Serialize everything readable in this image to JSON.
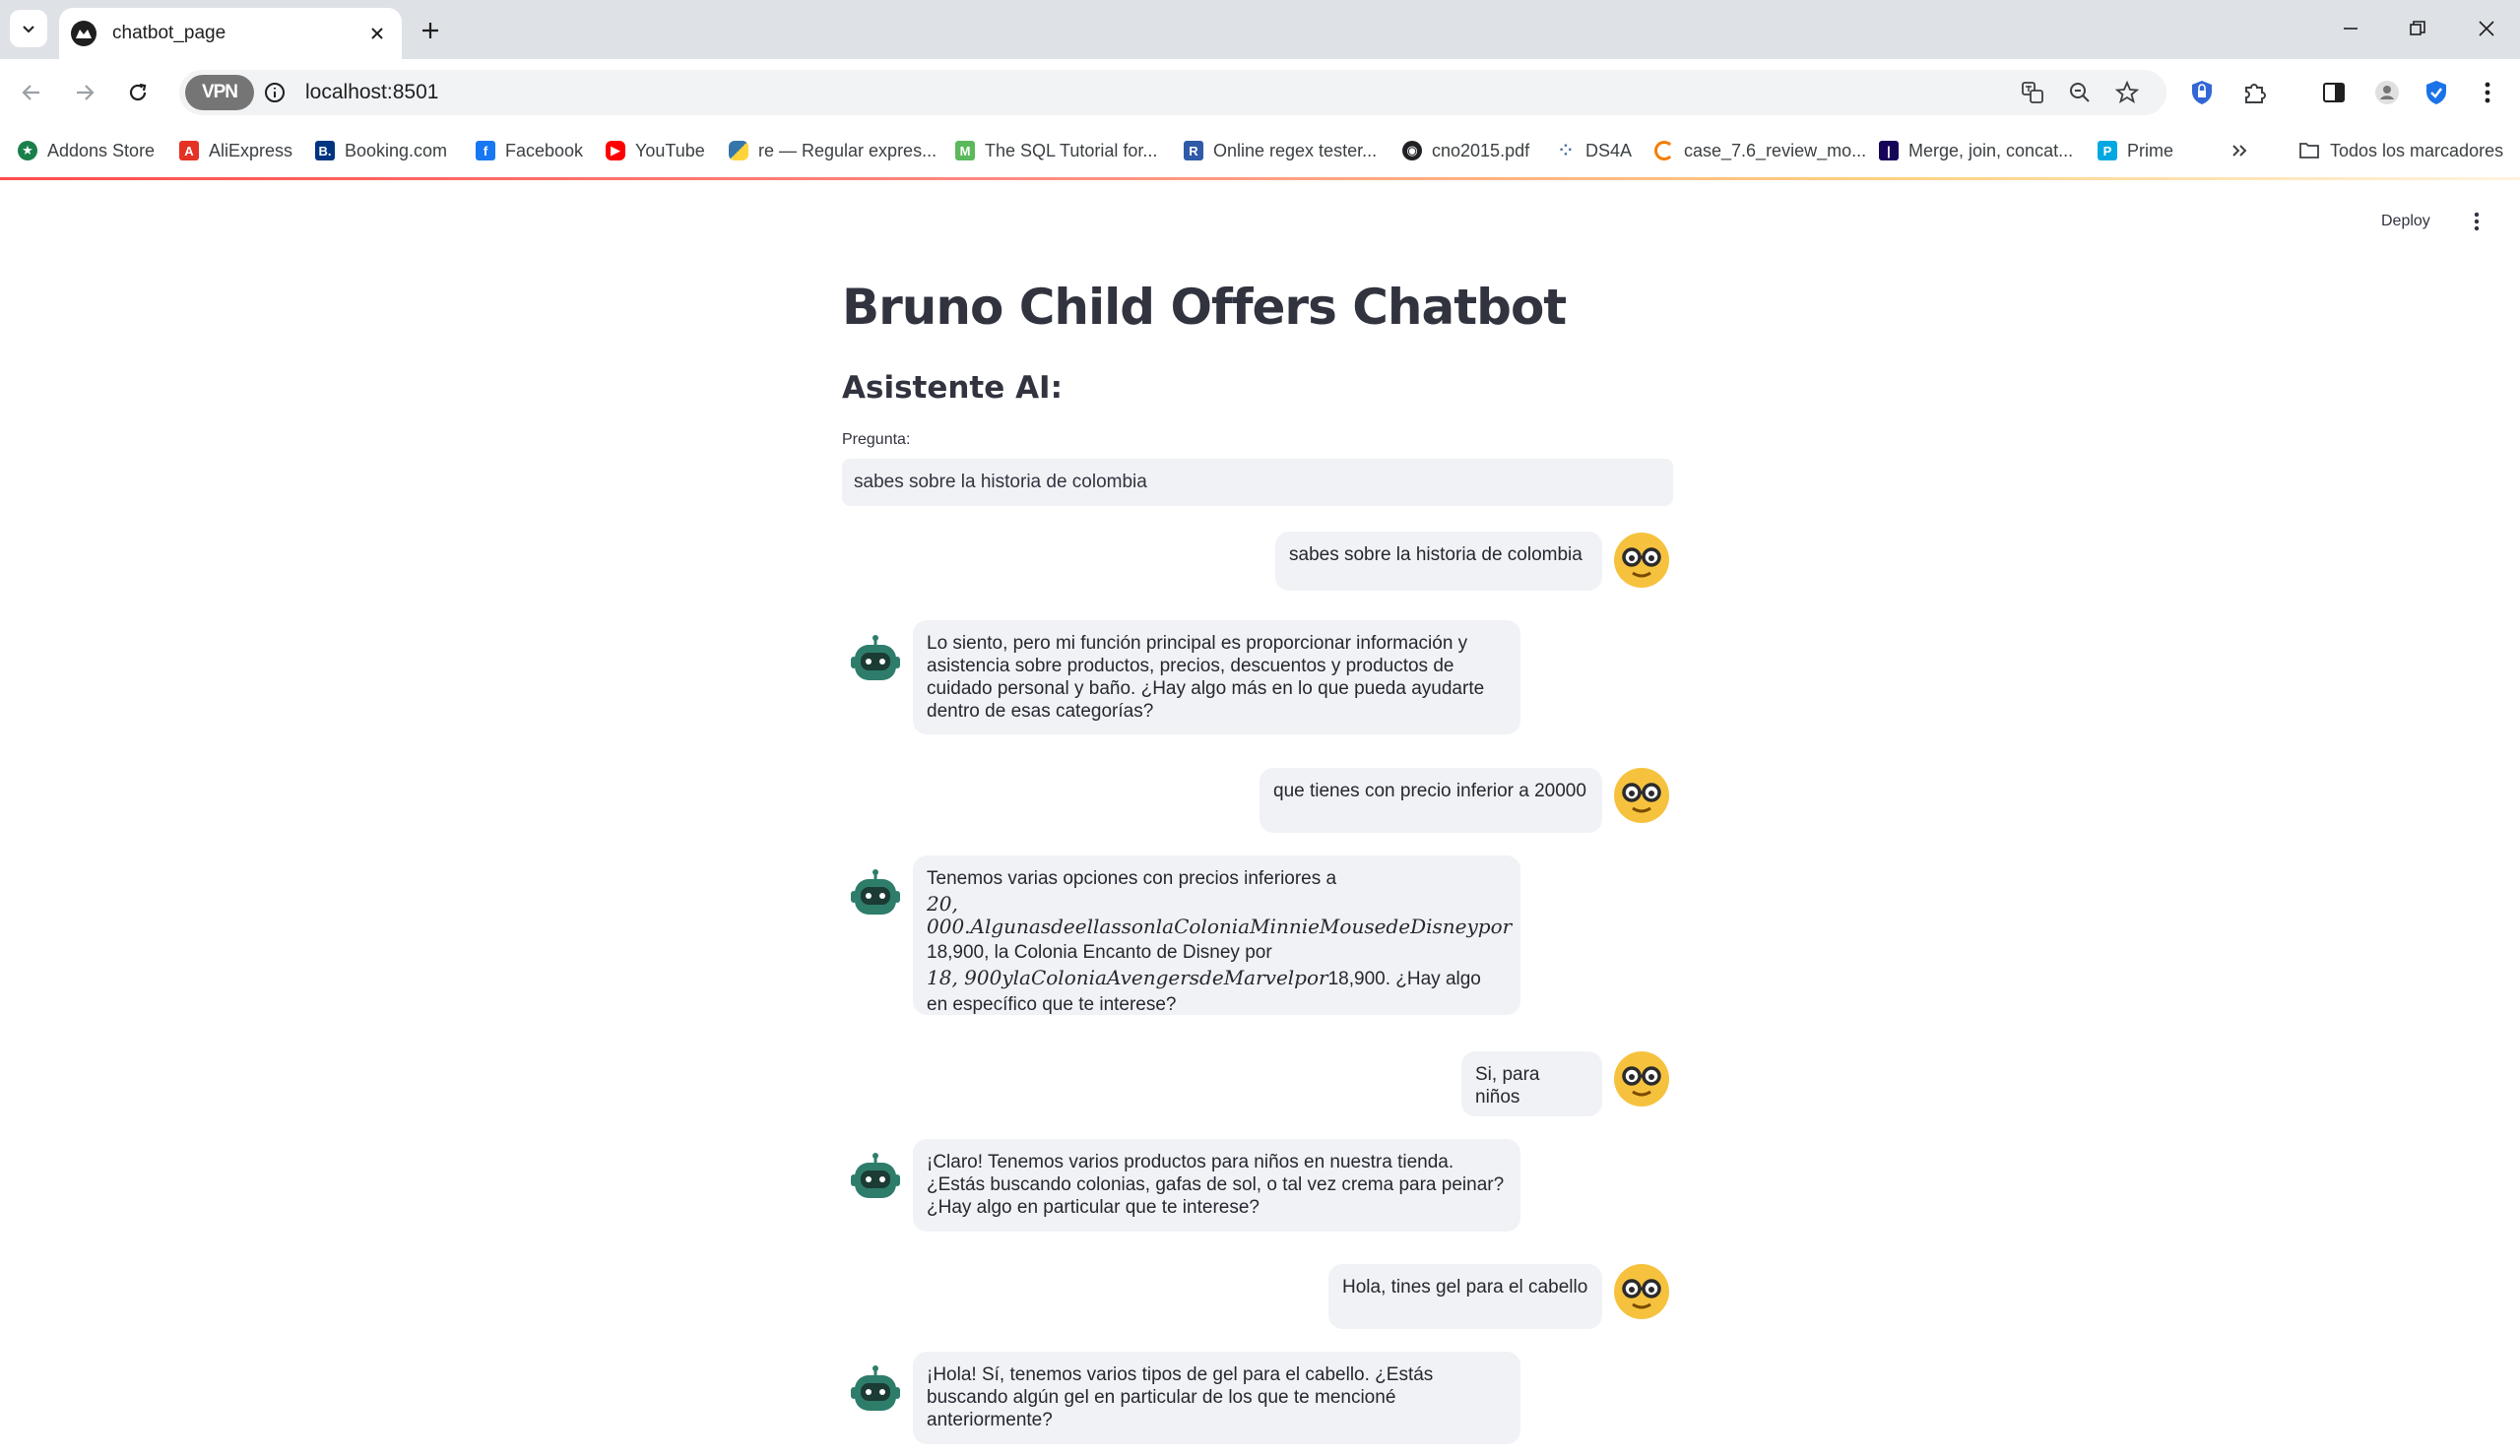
{
  "browser": {
    "tab_title": "chatbot_page",
    "url": "localhost:8501",
    "vpn_label": "VPN",
    "bookmarks": [
      {
        "label": "Addons Store",
        "icon": "addons-store-icon",
        "color": "#1a7f4b"
      },
      {
        "label": "AliExpress",
        "icon": "aliexpress-icon",
        "color": "#e43225"
      },
      {
        "label": "Booking.com",
        "icon": "booking-icon",
        "color": "#003580"
      },
      {
        "label": "Facebook",
        "icon": "facebook-icon",
        "color": "#1877f2"
      },
      {
        "label": "YouTube",
        "icon": "youtube-icon",
        "color": "#ff0000"
      },
      {
        "label": "re — Regular expres...",
        "icon": "python-icon",
        "color": "#3776ab"
      },
      {
        "label": "The SQL Tutorial for...",
        "icon": "mode-icon",
        "color": "#5cb85c"
      },
      {
        "label": "Online regex tester...",
        "icon": "regex-icon",
        "color": "#2f5aa8"
      },
      {
        "label": "cno2015.pdf",
        "icon": "globe-icon",
        "color": "#202124"
      },
      {
        "label": "DS4A",
        "icon": "ds4a-icon",
        "color": "#4a6fa5"
      },
      {
        "label": "case_7.6_review_mo...",
        "icon": "loading-icon",
        "color": "#f57c00"
      },
      {
        "label": "Merge, join, concat...",
        "icon": "pandas-icon",
        "color": "#150458"
      },
      {
        "label": "Prime",
        "icon": "prime-icon",
        "color": "#00a8e1"
      }
    ],
    "all_bookmarks_label": "Todos los marcadores"
  },
  "app": {
    "deploy_label": "Deploy",
    "title": "Bruno Child Offers Chatbot",
    "subtitle": "Asistente AI:",
    "question_label": "Pregunta:",
    "question_value": "sabes sobre la historia de colombia"
  },
  "chat": {
    "user_1": "sabes sobre la historia de colombia",
    "bot_1": "Lo siento, pero mi función principal es proporcionar información y asistencia sobre productos, precios, descuentos y productos de cuidado personal y baño. ¿Hay algo más en lo que pueda ayudarte dentro de esas categorías?",
    "user_2": "que tienes con precio inferior a 20000",
    "bot_2": {
      "l1": "Tenemos varias opciones con precios inferiores a",
      "l2": "20, 000.AlgunasdeellassonlaColoniaMinnieMousedeDisneypor",
      "l3": "18,900, la Colonia Encanto de Disney por",
      "l4a": "18, 900ylaColoniaAvengersdeMarvelpor",
      "l4b": "18,900. ¿Hay algo",
      "l5": "en específico que te interese?"
    },
    "user_3": "Si, para niños",
    "bot_3": "¡Claro! Tenemos varios productos para niños en nuestra tienda. ¿Estás buscando colonias, gafas de sol, o tal vez crema para peinar? ¿Hay algo en particular que te interese?",
    "user_4": "Hola, tines gel para el cabello",
    "bot_4": "¡Hola! Sí, tenemos varios tipos de gel para el cabello. ¿Estás buscando algún gel en particular de los que te mencioné anteriormente?"
  },
  "colors": {
    "bubble": "#f0f2f6",
    "user_avatar": "#f6c23e",
    "bot_avatar": "#2e7d6b",
    "accent": "#ff4b4b"
  }
}
